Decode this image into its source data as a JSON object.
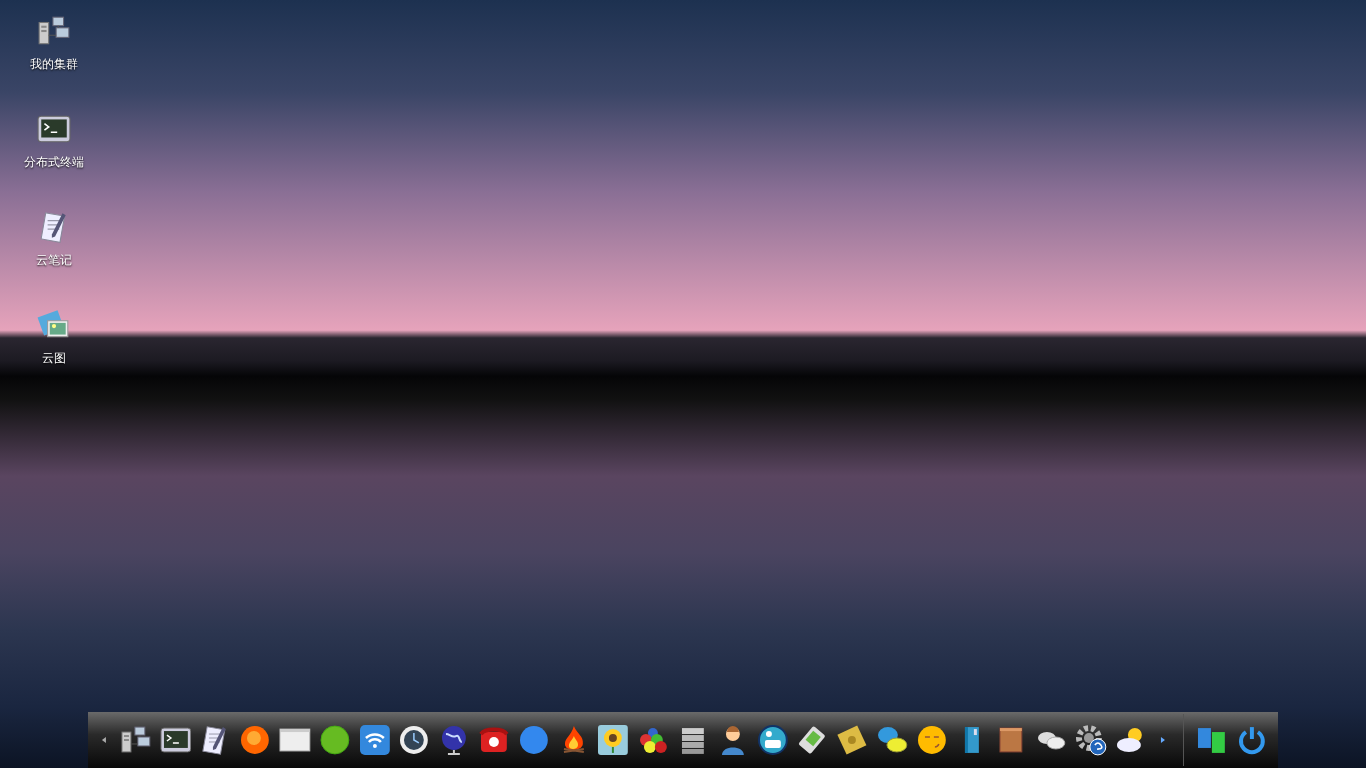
{
  "desktop_icons": [
    {
      "kind": "cluster",
      "label": "我的集群"
    },
    {
      "kind": "terminal",
      "label": "分布式终端"
    },
    {
      "kind": "notes",
      "label": "云笔记"
    },
    {
      "kind": "images",
      "label": "云图"
    }
  ],
  "dock": {
    "items": [
      {
        "kind": "prev"
      },
      {
        "kind": "cluster"
      },
      {
        "kind": "terminal"
      },
      {
        "kind": "notes"
      },
      {
        "kind": "orange"
      },
      {
        "kind": "window"
      },
      {
        "kind": "green"
      },
      {
        "kind": "wifi"
      },
      {
        "kind": "clock"
      },
      {
        "kind": "globe"
      },
      {
        "kind": "phone"
      },
      {
        "kind": "blue"
      },
      {
        "kind": "fire"
      },
      {
        "kind": "flower"
      },
      {
        "kind": "balls"
      },
      {
        "kind": "stack"
      },
      {
        "kind": "person"
      },
      {
        "kind": "smiley"
      },
      {
        "kind": "device"
      },
      {
        "kind": "disk"
      },
      {
        "kind": "chat"
      },
      {
        "kind": "face"
      },
      {
        "kind": "book"
      },
      {
        "kind": "box"
      },
      {
        "kind": "bubbles"
      },
      {
        "kind": "gearhelp"
      },
      {
        "kind": "weather"
      },
      {
        "kind": "next"
      },
      {
        "kind": "divider"
      },
      {
        "kind": "windows"
      },
      {
        "kind": "power"
      }
    ]
  }
}
